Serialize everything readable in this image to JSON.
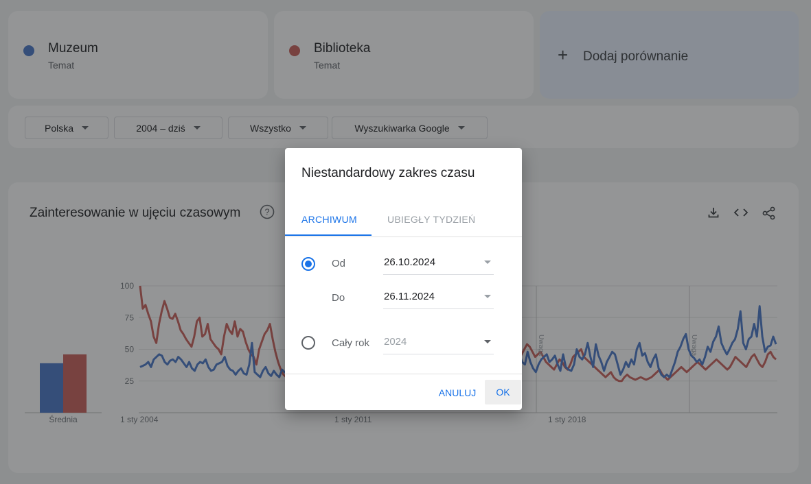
{
  "terms": [
    {
      "name": "Muzeum",
      "type": "Temat",
      "color": "#4a78c8"
    },
    {
      "name": "Biblioteka",
      "type": "Temat",
      "color": "#c9605a"
    }
  ],
  "add_comparison": {
    "icon": "plus-icon",
    "label": "Dodaj porównanie"
  },
  "filters": [
    {
      "label": "Polska"
    },
    {
      "label": "2004 – dziś"
    },
    {
      "label": "Wszystko"
    },
    {
      "label": "Wyszukiwarka Google"
    }
  ],
  "chart_section": {
    "title": "Zainteresowanie w ujęciu czasowym",
    "icons": [
      "help-icon",
      "download-icon",
      "embed-icon",
      "share-icon"
    ]
  },
  "chart_data": {
    "type": "line",
    "yticks": [
      100,
      75,
      50,
      25
    ],
    "ylim": [
      0,
      100
    ],
    "xticks": [
      "1 sty 2004",
      "1 sty 2011",
      "1 sty 2018"
    ],
    "average_label": "Średnia",
    "averages": [
      {
        "name": "Muzeum",
        "value": 39
      },
      {
        "name": "Biblioteka",
        "value": 46
      }
    ],
    "annotations": [
      "Uwaga",
      "Uwaga"
    ],
    "series": [
      {
        "name": "Muzeum",
        "color": "#4a78c8",
        "values": [
          36,
          37,
          38,
          40,
          36,
          42,
          44,
          46,
          45,
          40,
          38,
          41,
          42,
          40,
          44,
          42,
          39,
          36,
          40,
          35,
          33,
          38,
          40,
          39,
          42,
          36,
          33,
          34,
          38,
          39,
          40,
          44,
          37,
          34,
          33,
          30,
          33,
          35,
          31,
          30,
          38,
          55,
          32,
          30,
          28,
          33,
          36,
          31,
          29,
          33,
          30,
          28,
          34,
          32,
          30,
          28,
          52,
          45,
          29,
          27,
          30,
          33,
          32,
          35,
          42,
          38,
          33,
          31,
          36,
          45,
          55,
          40,
          35,
          33,
          30,
          38,
          42,
          40,
          36,
          42,
          38,
          35,
          33,
          30,
          35,
          40,
          45,
          38,
          42,
          40,
          48,
          46,
          44,
          42,
          40,
          45,
          50,
          44,
          42,
          38,
          36,
          40,
          44,
          48,
          45,
          43,
          41,
          36,
          32,
          38,
          44,
          42,
          40,
          38,
          35,
          40,
          42,
          38,
          43,
          48,
          44,
          40,
          50,
          45,
          38,
          45,
          41,
          34,
          42,
          36,
          32,
          40,
          50,
          44,
          42,
          45,
          48,
          60,
          44,
          46,
          40,
          38,
          48,
          40,
          35,
          32,
          38,
          42,
          44,
          46,
          40,
          42,
          45,
          38,
          33,
          46,
          36,
          34,
          33,
          38,
          50,
          44,
          42,
          46,
          55,
          44,
          36,
          54,
          45,
          40,
          33,
          40,
          44,
          48,
          46,
          38,
          30,
          34,
          40,
          36,
          42,
          38,
          50,
          55,
          45,
          47,
          40,
          36,
          42,
          46,
          35,
          30,
          28,
          30,
          28,
          34,
          40,
          48,
          52,
          58,
          62,
          50,
          45,
          43,
          40,
          42,
          38,
          44,
          52,
          48,
          56,
          60,
          68,
          55,
          50,
          46,
          50,
          55,
          58,
          66,
          80,
          55,
          50,
          58,
          60,
          70,
          60,
          84,
          60,
          48,
          52,
          53,
          60,
          54
        ]
      },
      {
        "name": "Biblioteka",
        "color": "#c9605a",
        "values": [
          100,
          82,
          85,
          78,
          72,
          60,
          55,
          70,
          80,
          88,
          82,
          75,
          74,
          78,
          72,
          65,
          62,
          58,
          55,
          52,
          60,
          72,
          75,
          60,
          62,
          70,
          58,
          55,
          52,
          50,
          46,
          60,
          70,
          65,
          62,
          72,
          60,
          66,
          64,
          56,
          50,
          46,
          44,
          38,
          50,
          56,
          62,
          65,
          70,
          58,
          48,
          40,
          34,
          30,
          28,
          36,
          44,
          52,
          58,
          60,
          66,
          64,
          56,
          50,
          46,
          44,
          40,
          36,
          45,
          52,
          58,
          64,
          68,
          62,
          56,
          52,
          48,
          44,
          40,
          46,
          54,
          58,
          60,
          52,
          48,
          46,
          42,
          40,
          38,
          44,
          48,
          52,
          56,
          54,
          50,
          46,
          44,
          40,
          38,
          42,
          46,
          50,
          48,
          46,
          42,
          40,
          38,
          40,
          44,
          48,
          52,
          50,
          46,
          42,
          40,
          38,
          36,
          38,
          40,
          42,
          46,
          48,
          44,
          40,
          38,
          36,
          34,
          36,
          40,
          44,
          48,
          46,
          42,
          40,
          38,
          36,
          34,
          32,
          34,
          38,
          42,
          46,
          50,
          54,
          52,
          48,
          44,
          46,
          48,
          44,
          40,
          38,
          36,
          34,
          38,
          42,
          40,
          36,
          34,
          38,
          44,
          46,
          48,
          50,
          44,
          42,
          40,
          38,
          36,
          34,
          32,
          30,
          28,
          30,
          32,
          28,
          26,
          25,
          25,
          28,
          30,
          28,
          27,
          26,
          27,
          28,
          27,
          26,
          27,
          28,
          30,
          32,
          34,
          30,
          28,
          26,
          28,
          30,
          32,
          34,
          36,
          34,
          32,
          34,
          36,
          38,
          40,
          38,
          36,
          34,
          36,
          38,
          40,
          42,
          40,
          38,
          36,
          34,
          36,
          40,
          44,
          42,
          40,
          38,
          36,
          40,
          44,
          46,
          42,
          38,
          36,
          40,
          46,
          48,
          44,
          42
        ]
      }
    ]
  },
  "dialog": {
    "title": "Niestandardowy zakres czasu",
    "tabs": [
      {
        "label": "ARCHIWUM",
        "active": true
      },
      {
        "label": "UBIEGŁY TYDZIEŃ",
        "active": false
      }
    ],
    "option_range": {
      "selected": true,
      "from_label": "Od",
      "from_value": "26.10.2024",
      "to_label": "Do",
      "to_value": "26.11.2024"
    },
    "option_year": {
      "selected": false,
      "label": "Cały rok",
      "value": "2024"
    },
    "cancel_label": "ANULUJ",
    "ok_label": "OK"
  }
}
